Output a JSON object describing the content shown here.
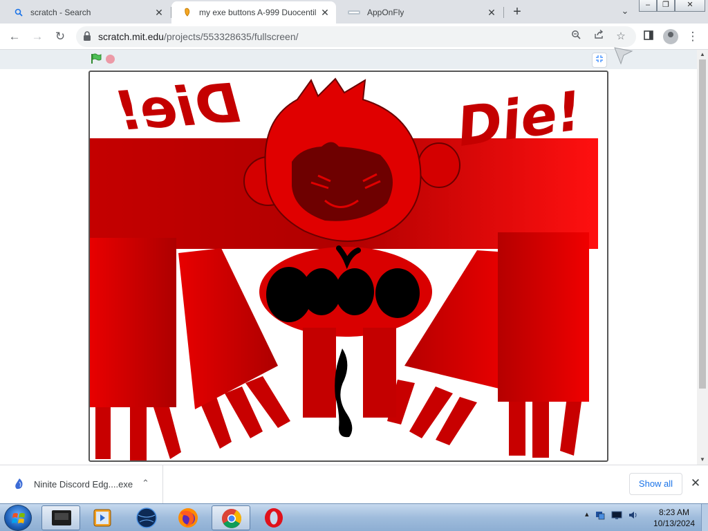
{
  "browser": {
    "tabs": [
      {
        "title": "scratch - Search",
        "icon": "search-icon",
        "active": false
      },
      {
        "title": "my exe buttons A-999 Duocentil",
        "icon": "scratch-favicon",
        "active": true
      },
      {
        "title": "AppOnFly",
        "icon": "apponfly-favicon",
        "active": false
      }
    ],
    "new_tab_label": "+",
    "url_host": "scratch.mit.edu",
    "url_path": "/projects/553328635/fullscreen/"
  },
  "stage": {
    "text_left": "Die!",
    "text_right": "Die!",
    "colors": {
      "primary_red": "#e00000",
      "dark_red": "#b00000",
      "black": "#000000"
    }
  },
  "downloads": {
    "file_name": "Ninite Discord Edg....exe",
    "show_all_label": "Show all"
  },
  "taskbar": {
    "apps": [
      "media-device-icon",
      "media-player-icon",
      "globe-icon",
      "firefox-icon",
      "chrome-icon",
      "opera-icon"
    ],
    "time": "8:23 AM",
    "date": "10/13/2024"
  }
}
